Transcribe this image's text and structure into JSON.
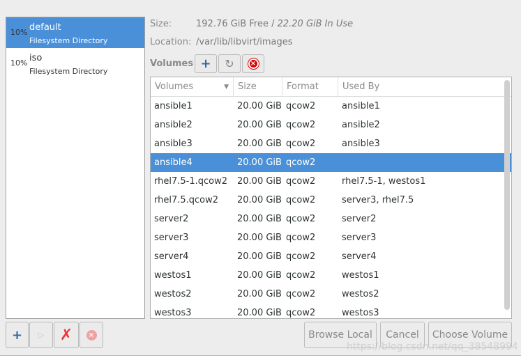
{
  "pools": [
    {
      "pct": "10%",
      "name": "default",
      "type": "Filesystem Directory",
      "selected": true
    },
    {
      "pct": "10%",
      "name": "iso",
      "type": "Filesystem Directory",
      "selected": false
    }
  ],
  "details": {
    "size_label": "Size:",
    "size_free": "192.76 GiB Free / ",
    "size_used": "22.20 GiB In Use",
    "location_label": "Location:",
    "location": "/var/lib/libvirt/images",
    "volumes_label": "Volumes"
  },
  "table": {
    "headers": [
      "Volumes",
      "Size",
      "Format",
      "Used By"
    ],
    "rows": [
      [
        "ansible1",
        "20.00 GiB",
        "qcow2",
        "ansible1"
      ],
      [
        "ansible2",
        "20.00 GiB",
        "qcow2",
        "ansible2"
      ],
      [
        "ansible3",
        "20.00 GiB",
        "qcow2",
        "ansible3"
      ],
      [
        "ansible4",
        "20.00 GiB",
        "qcow2",
        ""
      ],
      [
        "rhel7.5-1.qcow2",
        "20.00 GiB",
        "qcow2",
        "rhel7.5-1, westos1"
      ],
      [
        "rhel7.5.qcow2",
        "20.00 GiB",
        "qcow2",
        "server3, rhel7.5"
      ],
      [
        "server2",
        "20.00 GiB",
        "qcow2",
        "server2"
      ],
      [
        "server3",
        "20.00 GiB",
        "qcow2",
        "server3"
      ],
      [
        "server4",
        "20.00 GiB",
        "qcow2",
        "server4"
      ],
      [
        "westos1",
        "20.00 GiB",
        "qcow2",
        "westos1"
      ],
      [
        "westos2",
        "20.00 GiB",
        "qcow2",
        "westos2"
      ],
      [
        "westos3",
        "20.00 GiB",
        "qcow2",
        "westos3"
      ]
    ],
    "selected_index": 3
  },
  "buttons": {
    "browse": "Browse Local",
    "cancel": "Cancel",
    "choose": "Choose Volume"
  },
  "watermark": "https://blog.csdn.net/qq_38548994",
  "colors": {
    "selection": "#4a90d9"
  }
}
